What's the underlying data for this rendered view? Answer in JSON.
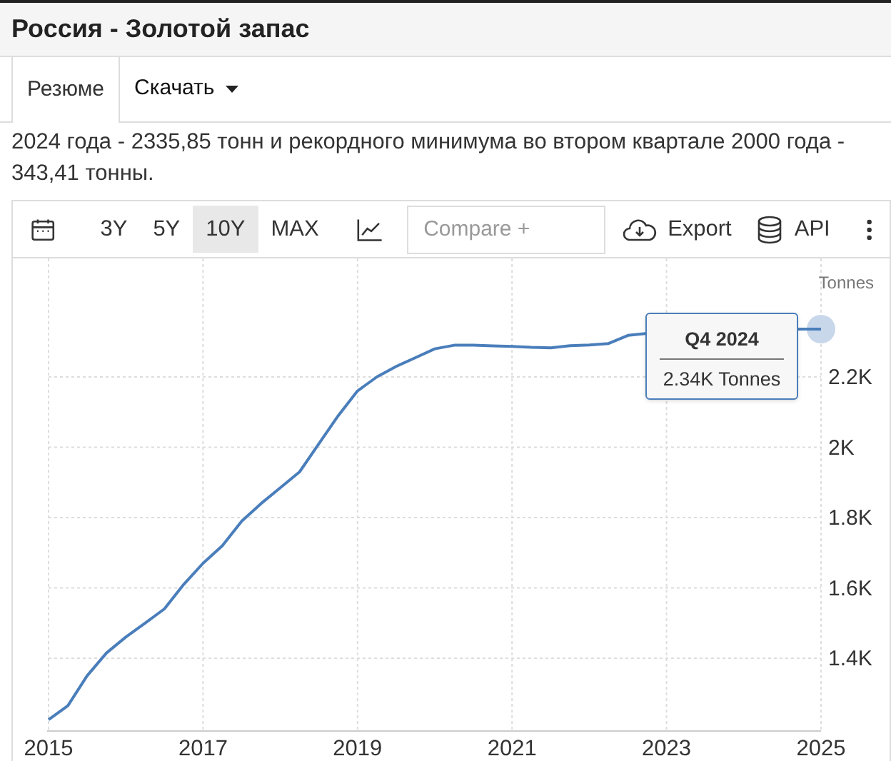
{
  "header": {
    "title": "Россия - Золотой запас"
  },
  "tabs": [
    {
      "label": "Резюме",
      "selected": true,
      "kind": "tab"
    },
    {
      "label": "Скачать",
      "selected": false,
      "kind": "dropdown"
    }
  ],
  "description": "2024 года - 2335,85 тонн и рекордного минимума во втором квартале 2000 года - 343,41 тонны.",
  "toolbar": {
    "ranges": [
      {
        "label": "3Y",
        "selected": false
      },
      {
        "label": "5Y",
        "selected": false
      },
      {
        "label": "10Y",
        "selected": true
      },
      {
        "label": "MAX",
        "selected": false
      }
    ],
    "compare": {
      "placeholder": "Compare +"
    },
    "export": "Export",
    "api": "API"
  },
  "chart": {
    "tooltip": {
      "title": "Q4 2024",
      "text": "2.34K Tonnes"
    },
    "chart_data": {
      "type": "line",
      "ylabel": "Tonnes",
      "x": [
        2015,
        2015.25,
        2015.5,
        2015.75,
        2016,
        2016.25,
        2016.5,
        2016.75,
        2017,
        2017.25,
        2017.5,
        2017.75,
        2018,
        2018.25,
        2018.5,
        2018.75,
        2019,
        2019.25,
        2019.5,
        2019.75,
        2020,
        2020.25,
        2020.5,
        2020.75,
        2021,
        2021.25,
        2021.5,
        2021.75,
        2022,
        2022.25,
        2022.5,
        2022.75,
        2024.75,
        2025
      ],
      "values": [
        1225,
        1265,
        1350,
        1415,
        1460,
        1500,
        1540,
        1610,
        1670,
        1720,
        1790,
        1840,
        1885,
        1930,
        2010,
        2090,
        2160,
        2200,
        2230,
        2255,
        2280,
        2290,
        2290,
        2288,
        2287,
        2284,
        2283,
        2289,
        2291,
        2295,
        2318,
        2324,
        2336,
        2336
      ],
      "xlim": [
        2015,
        2025
      ],
      "ylim": [
        1193,
        2537
      ],
      "grid": true,
      "xticks": [
        2015,
        2017,
        2019,
        2021,
        2023,
        2025
      ],
      "yticks": [
        {
          "value": 1400,
          "label": "1.4K"
        },
        {
          "value": 1600,
          "label": "1.6K"
        },
        {
          "value": 1800,
          "label": "1.8K"
        },
        {
          "value": 2000,
          "label": "2K"
        },
        {
          "value": 2200,
          "label": "2.2K"
        }
      ]
    }
  }
}
